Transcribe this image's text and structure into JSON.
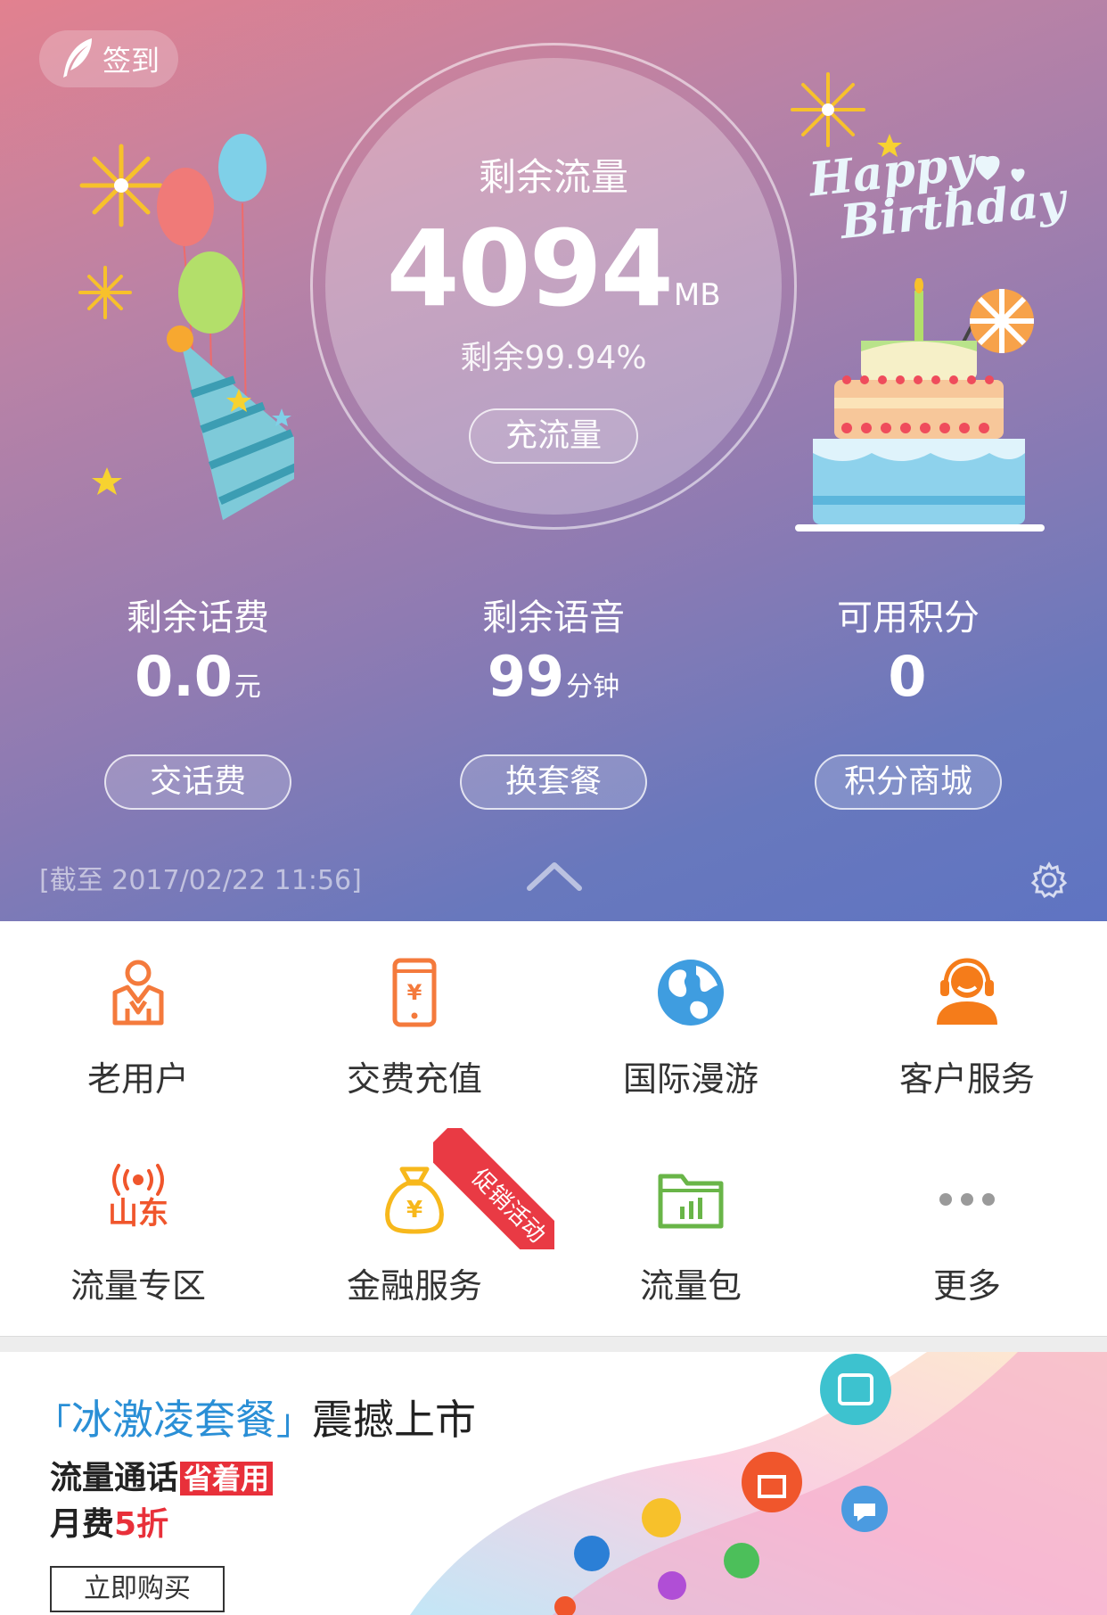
{
  "header": {
    "checkin_label": "签到"
  },
  "flow": {
    "label": "剩余流量",
    "value": "4094",
    "unit": "MB",
    "percent_text": "剩余99.94%",
    "button_label": "充流量"
  },
  "stats": [
    {
      "label": "剩余话费",
      "value": "0.0",
      "unit": "元",
      "button": "交话费"
    },
    {
      "label": "剩余语音",
      "value": "99",
      "unit": "分钟",
      "button": "换套餐"
    },
    {
      "label": "可用积分",
      "value": "0",
      "unit": "",
      "button": "积分商城"
    }
  ],
  "updated_text": "[截至 2017/02/22 11:56]",
  "birthday_text": {
    "line1": "Happy",
    "line2": "Birthday"
  },
  "grid": [
    {
      "label": "老用户",
      "icon": "old-user-icon"
    },
    {
      "label": "交费充值",
      "icon": "phone-recharge-icon"
    },
    {
      "label": "国际漫游",
      "icon": "globe-icon"
    },
    {
      "label": "客户服务",
      "icon": "customer-service-icon"
    },
    {
      "label": "流量专区",
      "icon": "shandong-signal-icon",
      "icon_text": "山东"
    },
    {
      "label": "金融服务",
      "icon": "money-bag-icon"
    },
    {
      "label": "流量包",
      "icon": "folder-chart-icon"
    },
    {
      "label": "更多",
      "icon": "more-dots-icon"
    }
  ],
  "promo_badge": "促销活动",
  "banner": {
    "title_highlight": "冰激凌套餐",
    "title_rest": "震撼上市",
    "line2_text": "流量通话",
    "line2_badge": "省着用",
    "line3_prefix": "月费",
    "line3_highlight": "5折",
    "buy_button": "立即购买"
  },
  "colors": {
    "accent_orange": "#f47a3c",
    "accent_red": "#e8303a",
    "accent_blue": "#2a8fd6",
    "accent_green": "#69b548"
  }
}
